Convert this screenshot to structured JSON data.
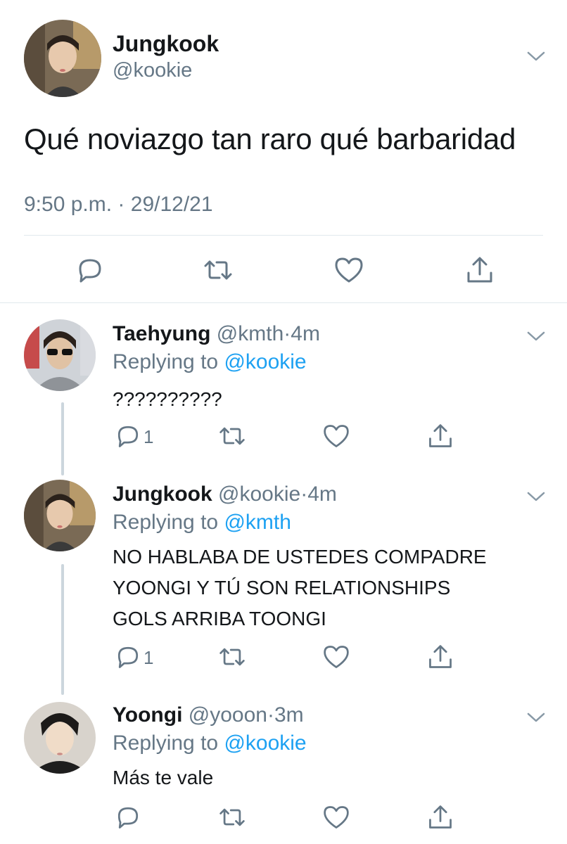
{
  "main_tweet": {
    "author_name": "Jungkook",
    "author_handle": "@kookie",
    "text": "Qué noviazgo tan raro qué barbaridad",
    "time": "9:50 p.m.",
    "separator": "·",
    "date": "29/12/21",
    "actions": [
      "reply-icon",
      "retweet-icon",
      "like-icon",
      "share-icon"
    ]
  },
  "replies": [
    {
      "name": "Taehyung",
      "handle": "@kmth",
      "separator": "·",
      "time": "4m",
      "replying_prefix": "Replying to",
      "replying_to": "@kookie",
      "text_lines": [
        "??????????"
      ],
      "reply_count": "1"
    },
    {
      "name": "Jungkook",
      "handle": "@kookie",
      "separator": "·",
      "time": "4m",
      "replying_prefix": "Replying to",
      "replying_to": "@kmth",
      "text_lines": [
        "NO HABLABA DE USTEDES COMPADRE",
        "YOONGI Y TÚ SON RELATIONSHIPS",
        "GOLS ARRIBA TOONGI"
      ],
      "reply_count": "1"
    },
    {
      "name": "Yoongi",
      "handle": "@yooon",
      "separator": "·",
      "time": "3m",
      "replying_prefix": "Replying to",
      "replying_to": "@kookie",
      "text_lines": [
        "Más te vale"
      ],
      "reply_count": ""
    }
  ],
  "colors": {
    "text": "#14171a",
    "secondary": "#657786",
    "link": "#1da1f2",
    "divider": "#e1e8ed",
    "thread_line": "#ccd6dd"
  }
}
